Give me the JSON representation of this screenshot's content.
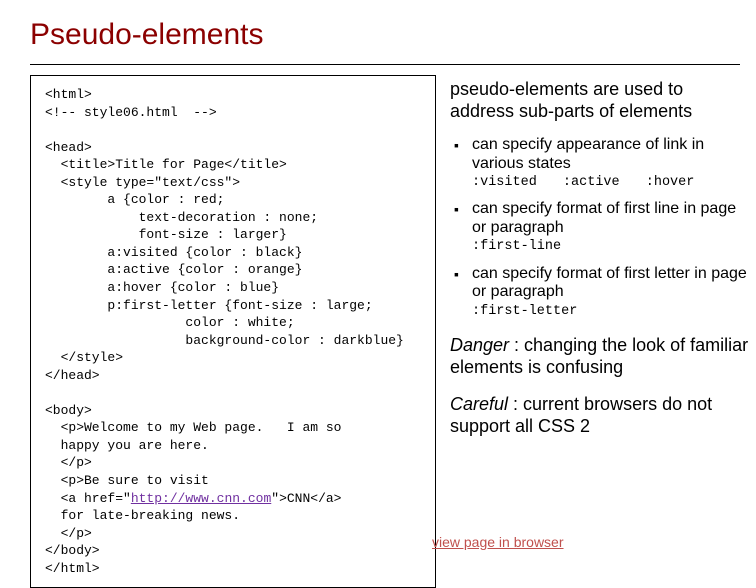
{
  "title": "Pseudo-elements",
  "code": {
    "l01": "<html>",
    "l02": "<!-- style06.html  -->",
    "l03": "",
    "l04": "<head>",
    "l05": "  <title>Title for Page</title>",
    "l06": "  <style type=\"text/css\">",
    "l07": "        a {color : red;",
    "l08": "            text-decoration : none;",
    "l09": "            font-size : larger}",
    "l10": "        a:visited {color : black}",
    "l11": "        a:active {color : orange}",
    "l12": "        a:hover {color : blue}",
    "l13": "        p:first-letter {font-size : large;",
    "l14": "                  color : white;",
    "l15": "                  background-color : darkblue}",
    "l16": "  </style>",
    "l17": "</head>",
    "l18": "",
    "l19": "<body>",
    "l20": "  <p>Welcome to my Web page.   I am so",
    "l21": "  happy you are here.",
    "l22": "  </p>",
    "l23": "  <p>Be sure to visit",
    "l24a": "  <a href=\"",
    "l24link": "http://www.cnn.com",
    "l24b": "\">CNN</a>",
    "l25": "  for late-breaking news.",
    "l26": "  </p>",
    "l27": "</body>",
    "l28": "</html>"
  },
  "intro": "pseudo-elements are used to address sub-parts of elements",
  "bullets": [
    {
      "text": "can specify appearance of link in various states",
      "sub": [
        ":visited",
        ":active",
        ":hover"
      ]
    },
    {
      "text": "can specify format of first line in page or paragraph",
      "sub": [
        ":first-line"
      ]
    },
    {
      "text": "can specify format of first letter in page or paragraph",
      "sub": [
        ":first-letter"
      ]
    }
  ],
  "danger_label": "Danger",
  "danger_text": " : changing the look of familiar elements is confusing",
  "careful_label": "Careful",
  "careful_text": " : current browsers do not support all CSS 2",
  "view_link": "view page in browser"
}
